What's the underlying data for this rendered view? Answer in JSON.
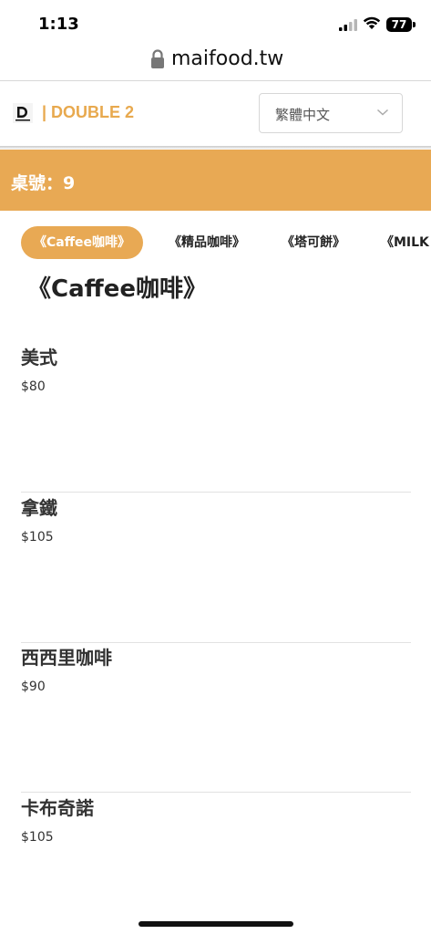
{
  "status_bar": {
    "time": "1:13",
    "battery": "77",
    "icons": [
      "signal-icon",
      "wifi-icon",
      "battery-icon"
    ]
  },
  "browser": {
    "url": "maifood.tw",
    "lock_icon": "lock-icon"
  },
  "header": {
    "brand": "| DOUBLE 2",
    "brand_color": "#e8a94e",
    "language_select": {
      "value": "繁體中文",
      "icon": "chevron-down-icon"
    }
  },
  "banner": {
    "label": "桌號：9",
    "color": "#e8a954"
  },
  "categories": [
    {
      "label": "《Caffee咖啡》",
      "active": true
    },
    {
      "label": "《精品咖啡》",
      "active": false
    },
    {
      "label": "《塔可餅》",
      "active": false
    },
    {
      "label": "《MILK",
      "active": false
    }
  ],
  "section": {
    "title": "《Caffee咖啡》"
  },
  "items": [
    {
      "name": "美式",
      "price": "$80"
    },
    {
      "name": "拿鐵",
      "price": "$105"
    },
    {
      "name": "西西里咖啡",
      "price": "$90"
    },
    {
      "name": "卡布奇諾",
      "price": "$105"
    }
  ]
}
